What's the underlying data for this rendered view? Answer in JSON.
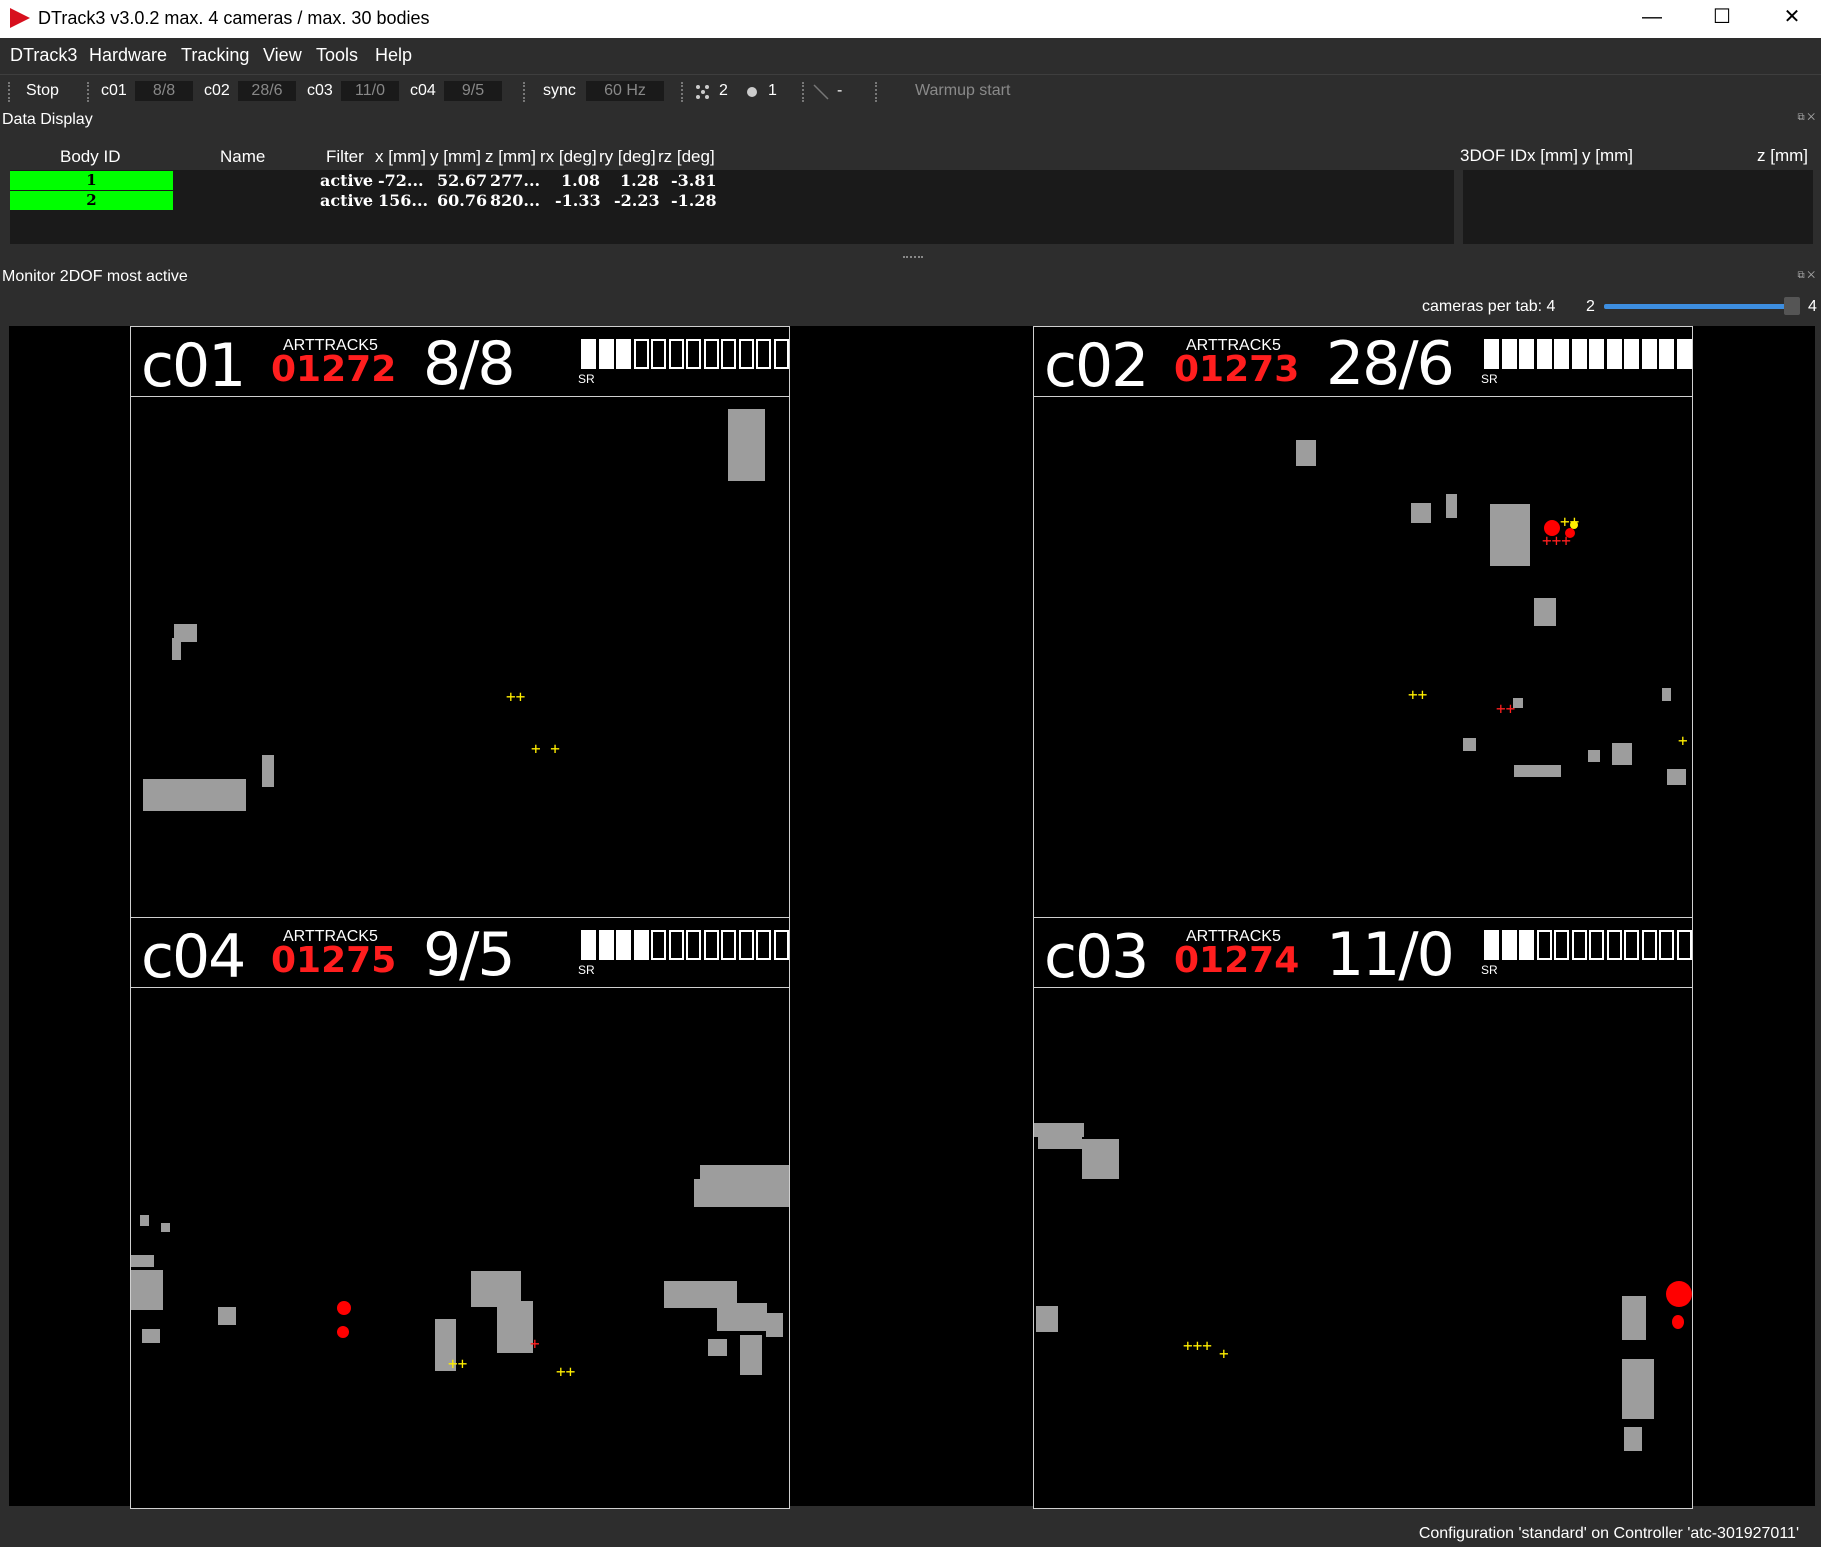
{
  "window": {
    "title": "DTrack3 v3.0.2 max. 4 cameras / max. 30 bodies",
    "min": "—",
    "max": "☐",
    "close": "✕"
  },
  "menu": {
    "items": [
      "DTrack3",
      "Hardware",
      "Tracking",
      "View",
      "Tools",
      "Help"
    ]
  },
  "toolbar": {
    "stop": "Stop",
    "cams": [
      {
        "name": "c01",
        "value": "8/8"
      },
      {
        "name": "c02",
        "value": "28/6"
      },
      {
        "name": "c03",
        "value": "11/0"
      },
      {
        "name": "c04",
        "value": "9/5"
      }
    ],
    "sync_label": "sync",
    "sync_value": "60 Hz",
    "markers_count": "2",
    "bodies_count": "1",
    "dash": "-",
    "warmup": "Warmup start"
  },
  "data_display": {
    "title": "Data Display",
    "dock_icons": "⧉ ✕",
    "headers": {
      "body_id": "Body ID",
      "name": "Name",
      "filter": "Filter",
      "x": "x [mm]",
      "y": "y [mm]",
      "z": "z [mm]",
      "rx": "rx [deg]",
      "ry": "ry [deg]",
      "rz": "rz [deg]"
    },
    "rows": [
      {
        "id": "1",
        "filter": "active",
        "x": "-72...",
        "y": "52.67",
        "z": "277...",
        "rx": "1.08",
        "ry": "1.28",
        "rz": "-3.81"
      },
      {
        "id": "2",
        "filter": "active",
        "x": "156...",
        "y": "60.76",
        "z": "820...",
        "rx": "-1.33",
        "ry": "-2.23",
        "rz": "-1.28"
      }
    ],
    "threedof_headers": {
      "id": "3DOF ID",
      "x": "x [mm]",
      "y": "y [mm]",
      "z": "z [mm]"
    },
    "id_color": "#00ff00"
  },
  "monitor": {
    "title": "Monitor 2DOF most active",
    "dock_icons": "⧉ ✕",
    "cameras_per_tab_label": "cameras per tab: 4",
    "slider_min": "2",
    "slider_max": "4",
    "slider_value": 4,
    "cameras": [
      {
        "name": "c01",
        "model": "ARTTRACK5",
        "serial": "01272",
        "count": "8/8",
        "sr": "SR",
        "signal_bars_on": 3,
        "signal_bars_total": 12
      },
      {
        "name": "c02",
        "model": "ARTTRACK5",
        "serial": "01273",
        "count": "28/6",
        "sr": "SR",
        "signal_bars_on": 12,
        "signal_bars_total": 12
      },
      {
        "name": "c04",
        "model": "ARTTRACK5",
        "serial": "01275",
        "count": "9/5",
        "sr": "SR",
        "signal_bars_on": 4,
        "signal_bars_total": 12
      },
      {
        "name": "c03",
        "model": "ARTTRACK5",
        "serial": "01274",
        "count": "11/0",
        "sr": "SR",
        "signal_bars_on": 3,
        "signal_bars_total": 12
      }
    ],
    "colors": {
      "blob": "#9d9d9d",
      "marker_2d": "#ffee00",
      "reflex": "#ff0000",
      "serial": "#ff1e1e"
    }
  },
  "status": {
    "text": "Configuration 'standard' on Controller 'atc-301927011'"
  }
}
